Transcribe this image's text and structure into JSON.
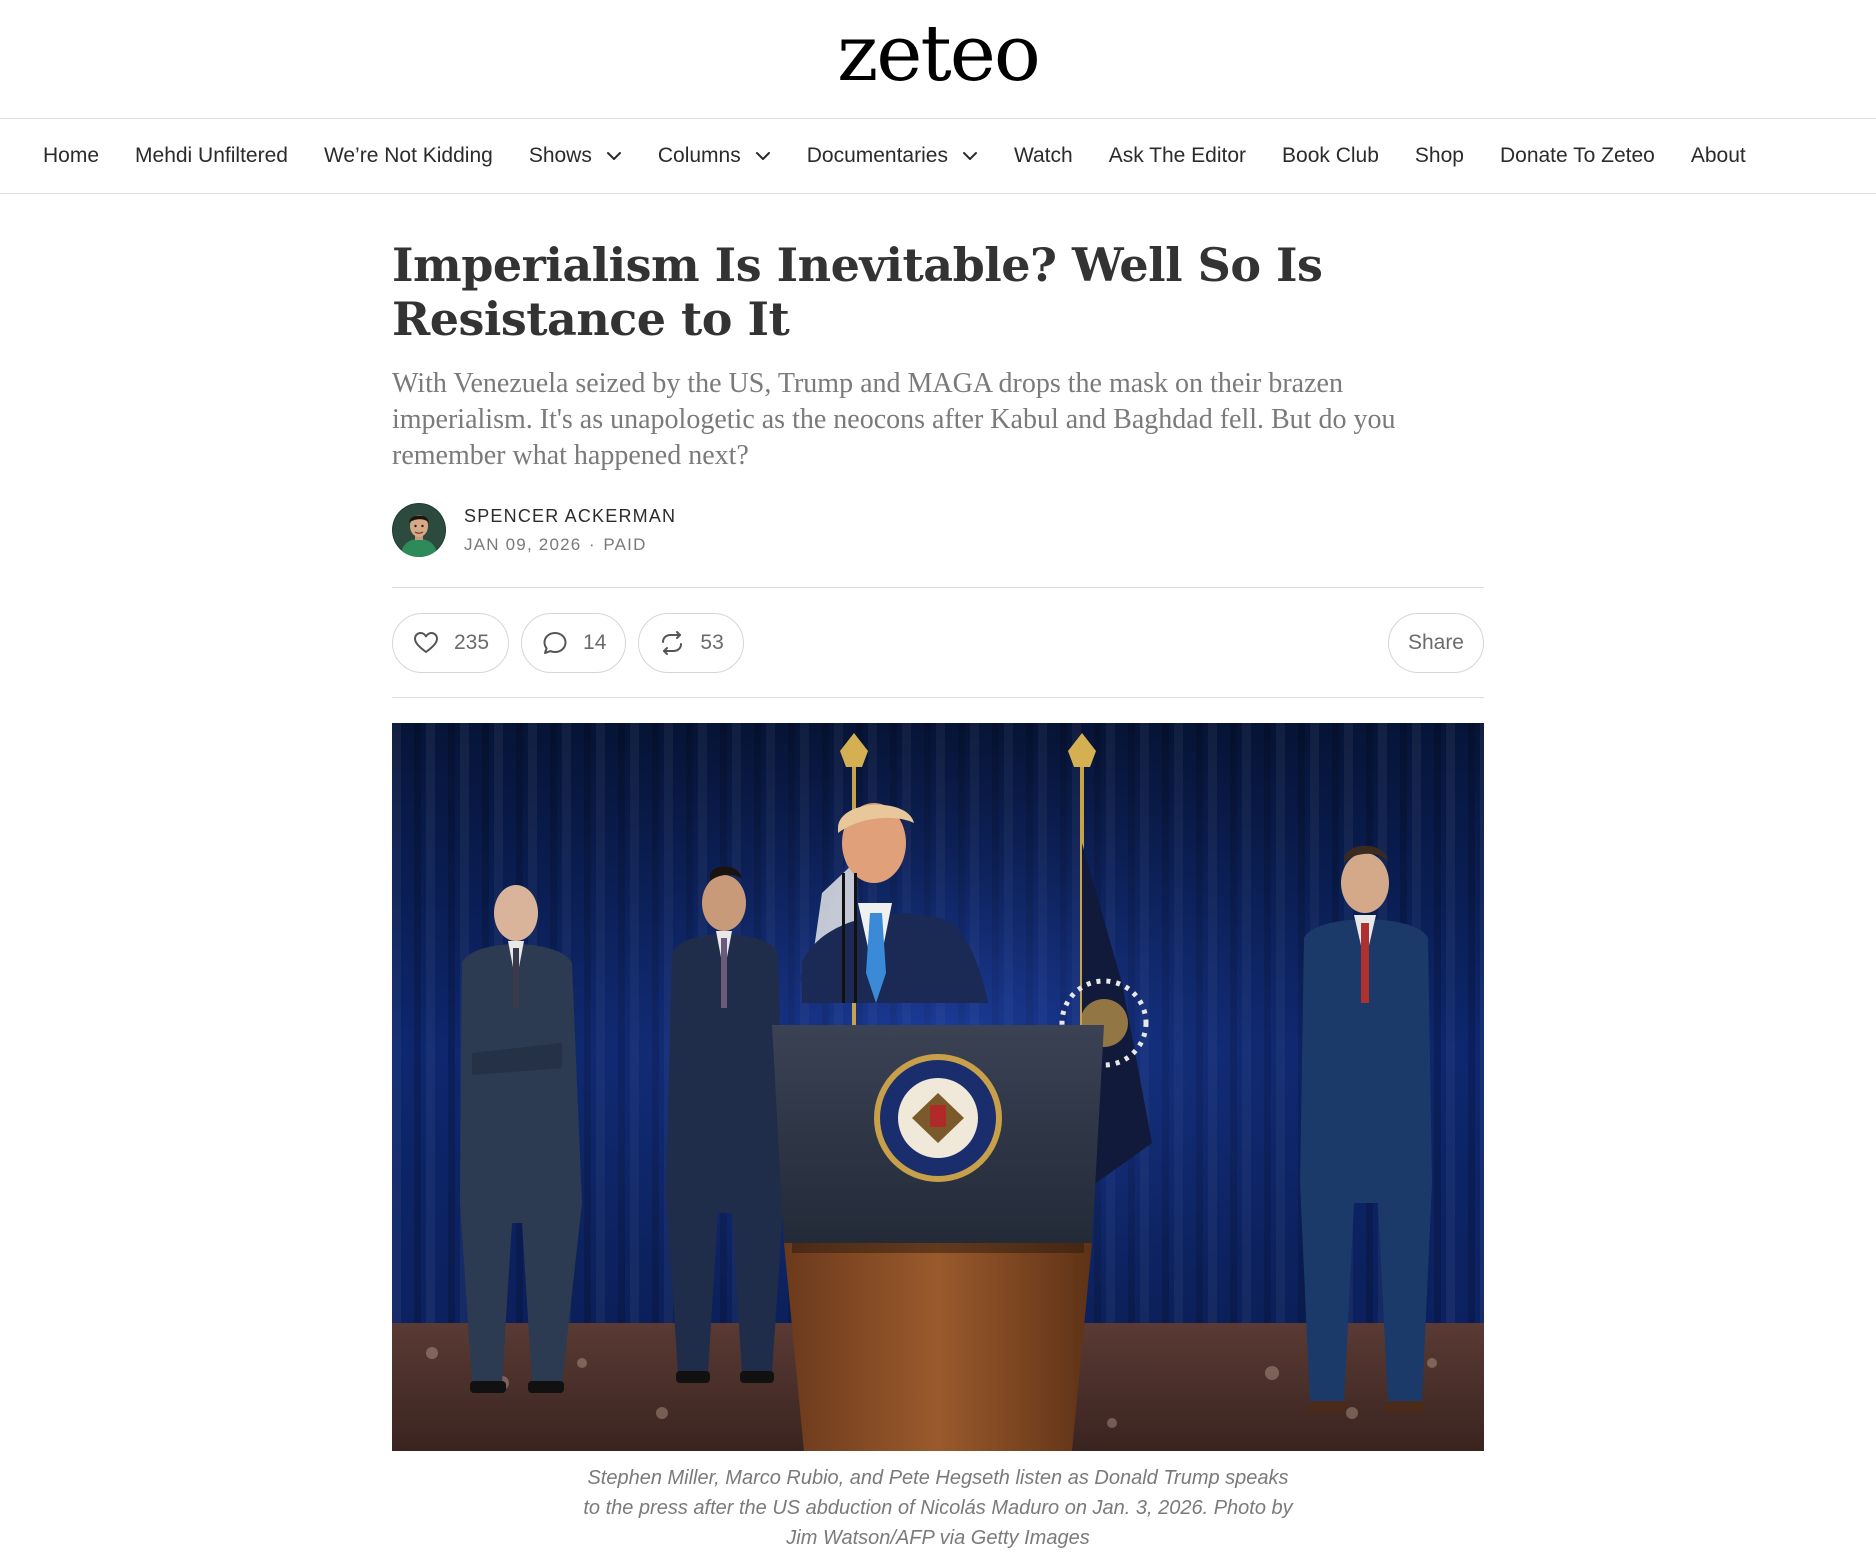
{
  "brand": {
    "logo": "zeteo"
  },
  "nav": {
    "items": [
      {
        "label": "Home",
        "dropdown": false
      },
      {
        "label": "Mehdi Unfiltered",
        "dropdown": false
      },
      {
        "label": "We’re Not Kidding",
        "dropdown": false
      },
      {
        "label": "Shows",
        "dropdown": true
      },
      {
        "label": "Columns",
        "dropdown": true
      },
      {
        "label": "Documentaries",
        "dropdown": true
      },
      {
        "label": "Watch",
        "dropdown": false
      },
      {
        "label": "Ask The Editor",
        "dropdown": false
      },
      {
        "label": "Book Club",
        "dropdown": false
      },
      {
        "label": "Shop",
        "dropdown": false
      },
      {
        "label": "Donate To Zeteo",
        "dropdown": false
      },
      {
        "label": "About",
        "dropdown": false
      }
    ]
  },
  "article": {
    "title": "Imperialism Is Inevitable? Well So Is Resistance to It",
    "subtitle": "With Venezuela seized by the US, Trump and MAGA drops the mask on their brazen imperialism. It's as unapologetic as the neocons after Kabul and Baghdad fell. But do you remember what happened next?",
    "author": "SPENCER ACKERMAN",
    "date": "JAN 09, 2026",
    "access": "PAID",
    "separator": "∙"
  },
  "actions": {
    "likes": "235",
    "comments": "14",
    "restacks": "53",
    "share_label": "Share"
  },
  "hero": {
    "caption": "Stephen Miller, Marco Rubio, and Pete Hegseth listen as Donald Trump speaks to the press after the US abduction of Nicolás Maduro on Jan. 3, 2026. Photo by Jim Watson/AFP via Getty Images"
  },
  "icons": {
    "like": "heart-icon",
    "comment": "comment-bubble-icon",
    "restack": "restack-icon",
    "dropdown": "chevron-down-icon"
  },
  "colors": {
    "text_primary": "#333333",
    "text_secondary": "#7a7a7a",
    "border": "#dcdcdc",
    "curtain_blue": "#0e2a78"
  }
}
